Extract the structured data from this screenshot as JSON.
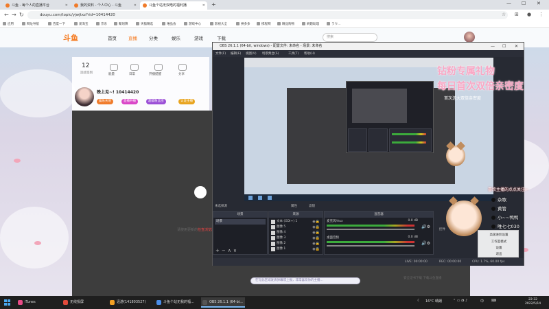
{
  "browser": {
    "tabs": [
      {
        "label": "斗鱼 - 每个人的直播平台"
      },
      {
        "label": "我的资料 - 个人中心 - 斗鱼"
      },
      {
        "label": "斗鱼个站无双皓的福利播"
      }
    ],
    "new_tab": "+",
    "url": "douyu.com/topic/yjwjtxz?rid=10414420",
    "bookmarks": [
      "应用",
      "网址导航",
      "百度一下",
      "爱淘宝",
      "京东",
      "聚划算",
      "天猫精选",
      "唯品会",
      "游戏中心",
      "影视大全",
      "拼多多",
      "携程网",
      "精品购物",
      "刷题助理",
      "ラウ..."
    ]
  },
  "douyu": {
    "logo": "斗鱼",
    "nav": [
      "首页",
      "直播",
      "分类",
      "娱乐",
      "游戏",
      "下载"
    ],
    "search_placeholder": "搜索",
    "room": {
      "count": "12",
      "count_sub": "连续签到",
      "actions": [
        "能量",
        "日常",
        "开播提醒",
        "分享"
      ],
      "streamer_name": "晚上见~! 10414420",
      "tags": [
        "娱乐天地",
        "直播开播",
        "超级粉丝团",
        "认证主播"
      ]
    },
    "player_note_prefix": "请使用更新的",
    "player_note_link": "检查浏览器",
    "chat_input": "在写此区域发表弹幕或上报，非常喜欢你的主播...",
    "bottom_right": "安全证书下载    下载斗鱼直播"
  },
  "obs": {
    "title": "OBS 26.1.1 (64-bit, windows) - 配置文件: 未命名 - 场景: 未命名",
    "menu": [
      "文件(F)",
      "编辑(E)",
      "视图(V)",
      "场景集合(S)",
      "工具(T)",
      "帮助(H)"
    ],
    "no_source": "未选择源",
    "properties": "属性",
    "filters": "滤镜",
    "docks": {
      "scenes": "场景",
      "sources": "来源",
      "mixer": "混音器"
    },
    "scene_items": [
      "场景"
    ],
    "sources": [
      "文本 (GDI+) 1",
      "图像 5",
      "图像 4",
      "图像 3",
      "图像 2",
      "图像 1"
    ],
    "mixer": [
      {
        "name": "麦克风/Aux",
        "db": "0.0 dB"
      },
      {
        "name": "桌面音频",
        "db": "0.0 dB"
      }
    ],
    "controls_label": "控件",
    "status": {
      "live": "LIVE: 00:00:00",
      "rec": "REC: 00:00:00",
      "cpu": "CPU: 1.7%, 60.00 fps"
    }
  },
  "overlay": {
    "promo_line1": "钻粉专属礼物",
    "promo_line2": "每日首次双倍亲密度",
    "promo_line3": "首次送大双倍亲密度",
    "follow_msg": "喜欢主播的点点关注~",
    "fans": [
      "杂歌",
      "黄管",
      "小~~鸭鸭",
      "唯七七030"
    ],
    "ctx_menu": [
      "高级进阶设置",
      "工作室模式",
      "设置",
      "退出"
    ]
  },
  "taskbar": {
    "items": [
      {
        "label": "iTunes",
        "color": "#e94b87"
      },
      {
        "label": "无线投屏",
        "color": "#e24a3b"
      },
      {
        "label": "迅游(141803527)",
        "color": "#f2a024"
      },
      {
        "label": "斗鱼个站无我的福...",
        "color": "#4a8de8"
      },
      {
        "label": "OBS 26.1.1 (64-bi...",
        "color": "#222222"
      }
    ],
    "weather": "16°C  晴朗",
    "lang": "中",
    "time": "22:32",
    "date": "2022/5/14"
  }
}
